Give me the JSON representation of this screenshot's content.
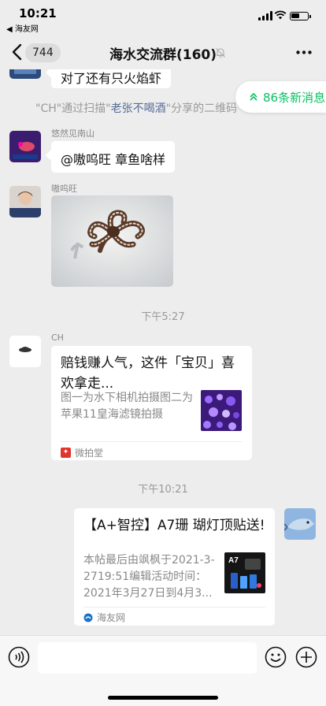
{
  "status_bar": {
    "time": "10:21",
    "back_app": "◀ 海友网"
  },
  "nav": {
    "unread_badge": "744",
    "title": "海水交流群(160)"
  },
  "new_messages_pill": "86条新消息",
  "messages": {
    "cut_top_text": "对了还有只火焰虾",
    "system_notice": {
      "p1": "\"CH\"通过扫描\"",
      "name": "老张不喝酒",
      "p2": "\"分享的二维码"
    },
    "msg1": {
      "sender": "悠然见南山",
      "text": "@嗷呜旺 章鱼啥样"
    },
    "msg2": {
      "sender": "嗷呜旺"
    },
    "time1": "下午5:27",
    "card1": {
      "sender": "CH",
      "title": "赔钱赚人气，这件「宝贝」喜欢拿走...",
      "desc": "图一为水下相机拍摄图二为苹果11皇海滤镜拍摄",
      "source": "微拍堂",
      "source_color": "#e0352b"
    },
    "time2": "下午10:21",
    "card2": {
      "title": "【A+智控】A7珊 瑚灯顶贴送!",
      "desc": "本帖最后由飒枫于2021-3-2719:51编辑活动时间：2021年3月27日到4月3...",
      "source": "海友网",
      "thumb_label": "A7"
    }
  },
  "colors": {
    "background": "#ededed",
    "accent_green": "#07c160",
    "link_blue": "#576b95"
  }
}
